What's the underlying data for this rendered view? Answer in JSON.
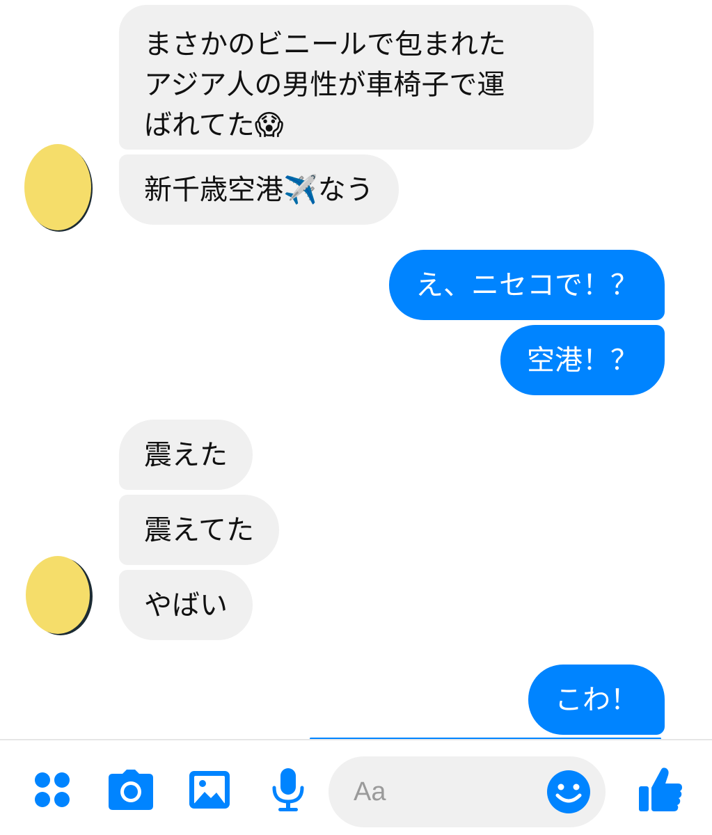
{
  "theme": {
    "accent": "#0084ff",
    "incoming_bg": "#f0f0f0",
    "avatar_color": "#f5dd6a"
  },
  "messages": [
    {
      "direction": "incoming",
      "text_lines": [
        "まさかのビニールで包まれた",
        "アジア人の男性が車椅子で運",
        "ばれてた😱"
      ]
    },
    {
      "direction": "incoming",
      "text": "新千歳空港✈️なう"
    },
    {
      "direction": "outgoing",
      "text": "え、ニセコで！？"
    },
    {
      "direction": "outgoing",
      "text": "空港！？"
    },
    {
      "direction": "incoming",
      "text": "震えた"
    },
    {
      "direction": "incoming",
      "text": "震えてた"
    },
    {
      "direction": "incoming",
      "text": "やばい"
    },
    {
      "direction": "outgoing",
      "text": "こわ！"
    }
  ],
  "composer": {
    "placeholder": "Aa",
    "icons": [
      "apps-icon",
      "camera-icon",
      "gallery-icon",
      "microphone-icon",
      "emoji-icon",
      "thumbs-up-icon"
    ]
  }
}
